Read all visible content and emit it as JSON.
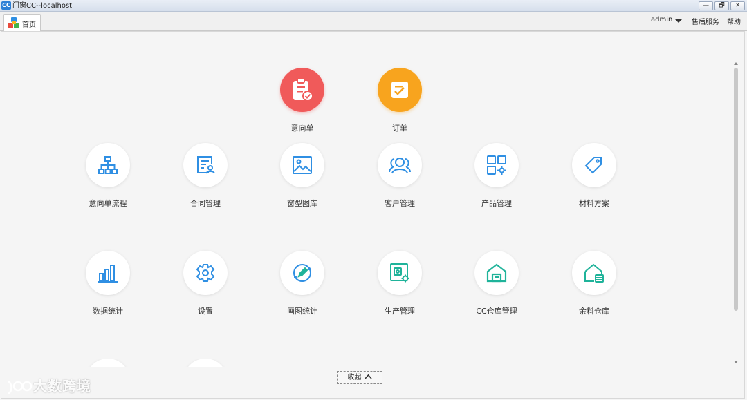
{
  "window": {
    "title": "门窗CC--localhost",
    "logo_text": "CC",
    "minimize_symbol": "—",
    "restore_symbol": "🗗",
    "close_symbol": "✕"
  },
  "tabs": [
    {
      "label": "首页",
      "icon": "cubes-icon"
    }
  ],
  "header": {
    "user": "admin",
    "user_menu_icon": "caret-down-icon",
    "links": [
      "售后服务",
      "帮助"
    ]
  },
  "featured": [
    {
      "label": "意向单",
      "icon": "clipboard-check-icon",
      "color": "#f05a5a"
    },
    {
      "label": "订单",
      "icon": "order-check-icon",
      "color": "#f8a41e"
    }
  ],
  "modules_row1": [
    {
      "label": "意向单流程",
      "icon": "org-chart-icon"
    },
    {
      "label": "合同管理",
      "icon": "contract-icon"
    },
    {
      "label": "窗型图库",
      "icon": "image-icon"
    },
    {
      "label": "客户管理",
      "icon": "customers-icon"
    },
    {
      "label": "产品管理",
      "icon": "product-grid-icon"
    },
    {
      "label": "材料方案",
      "icon": "tag-icon"
    }
  ],
  "modules_row2": [
    {
      "label": "数据统计",
      "icon": "bar-chart-icon"
    },
    {
      "label": "设置",
      "icon": "gear-icon"
    },
    {
      "label": "画图统计",
      "icon": "drawing-icon"
    },
    {
      "label": "生产管理",
      "icon": "production-icon"
    },
    {
      "label": "CC仓库管理",
      "icon": "warehouse-icon"
    },
    {
      "label": "余料仓库",
      "icon": "surplus-warehouse-icon"
    }
  ],
  "collapse": {
    "label": "收起",
    "icon": "chevron-up-icon"
  },
  "watermark": {
    "text": "大数跨境"
  },
  "colors": {
    "blue_icon": "#2f8fe3",
    "teal_icon": "#1fb39a",
    "red": "#f05a5a",
    "orange": "#f8a41e"
  }
}
